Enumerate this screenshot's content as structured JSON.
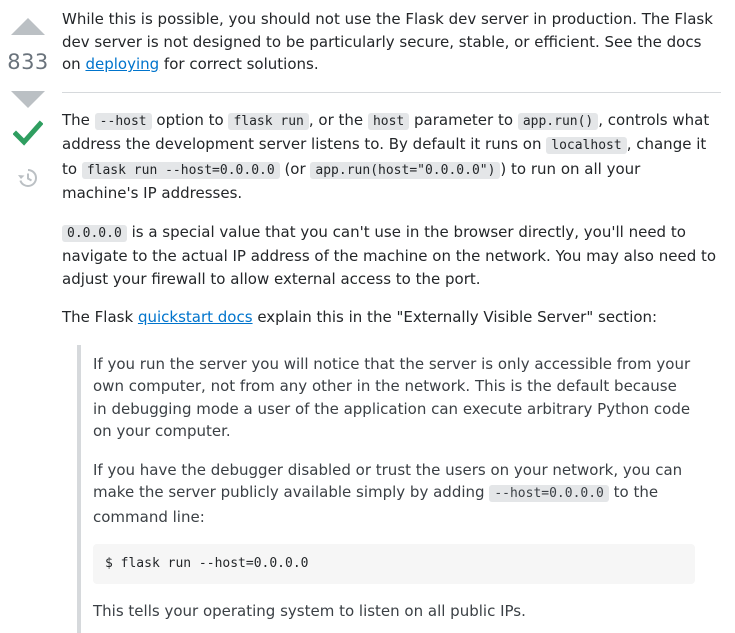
{
  "vote": {
    "count": "833",
    "icons": {
      "upvote": "arrow-up-icon",
      "downvote": "arrow-down-icon",
      "accepted": "check-icon",
      "history": "history-icon"
    },
    "accepted_color": "#2f9e60"
  },
  "answer": {
    "p1": {
      "text_before": "While this is possible, you should not use the Flask dev server in production. The Flask dev server is not designed to be particularly secure, stable, or efficient. See the docs on ",
      "link": "deploying",
      "text_after": " for correct solutions."
    },
    "p2": {
      "t1": "The ",
      "c1": "--host",
      "t2": " option to ",
      "c2": "flask run",
      "t3": ", or the ",
      "c3": "host",
      "t4": " parameter to ",
      "c4": "app.run()",
      "t5": ", controls what address the development server listens to. By default it runs on ",
      "c5": "localhost",
      "t6": ", change it to ",
      "c6": "flask run --host=0.0.0.0",
      "t7": " (or ",
      "c7": "app.run(host=\"0.0.0.0\")",
      "t8": ") to run on all your machine's IP addresses."
    },
    "p3": {
      "c1": "0.0.0.0",
      "text": " is a special value that you can't use in the browser directly, you'll need to navigate to the actual IP address of the machine on the network. You may also need to adjust your firewall to allow external access to the port."
    },
    "p4": {
      "text_before": "The Flask ",
      "link": "quickstart docs",
      "text_after": " explain this in the \"Externally Visible Server\" section:"
    },
    "quote": {
      "q1": "If you run the server you will notice that the server is only accessible from your own computer, not from any other in the network. This is the default because in debugging mode a user of the application can execute arbitrary Python code on your computer.",
      "q2_before": "If you have the debugger disabled or trust the users on your network, you can make the server publicly available simply by adding ",
      "q2_code": "--host=0.0.0.0",
      "q2_after": " to the command line:",
      "code_block": "$ flask run --host=0.0.0.0",
      "q3": "This tells your operating system to listen on all public IPs."
    }
  }
}
